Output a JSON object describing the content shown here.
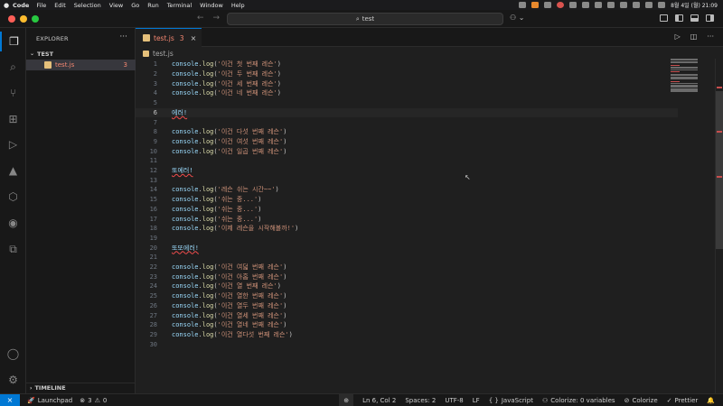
{
  "menubar": {
    "app": "Code",
    "items": [
      "File",
      "Edit",
      "Selection",
      "View",
      "Go",
      "Run",
      "Terminal",
      "Window",
      "Help"
    ],
    "clock": "8월 4일 (월) 21:09"
  },
  "titlebar": {
    "search_text": "test"
  },
  "sidebar": {
    "header": "EXPLORER",
    "folder": "TEST",
    "file_name": "test.js",
    "file_problems": "3",
    "timeline": "TIMELINE"
  },
  "tab": {
    "label": "test.js",
    "problems": "3"
  },
  "breadcrumb": {
    "file": "test.js"
  },
  "editor": {
    "current_line": 6,
    "lines": [
      {
        "n": "1",
        "kind": "log",
        "arg": "'이건 첫 번째 레슨'"
      },
      {
        "n": "2",
        "kind": "log",
        "arg": "'이건 두 번째 레슨'"
      },
      {
        "n": "3",
        "kind": "log",
        "arg": "'이건 세 번째 레슨'"
      },
      {
        "n": "4",
        "kind": "log",
        "arg": "'이건 네 번째 레슨'"
      },
      {
        "n": "5",
        "kind": "blank",
        "arg": ""
      },
      {
        "n": "6",
        "kind": "err",
        "arg": "에러!"
      },
      {
        "n": "7",
        "kind": "blank",
        "arg": ""
      },
      {
        "n": "8",
        "kind": "log",
        "arg": "'이건 다섯 번째 레슨'"
      },
      {
        "n": "9",
        "kind": "log",
        "arg": "'이건 여섯 번째 레슨'"
      },
      {
        "n": "10",
        "kind": "log",
        "arg": "'이건 일곱 번째 레슨'"
      },
      {
        "n": "11",
        "kind": "blank",
        "arg": ""
      },
      {
        "n": "12",
        "kind": "err",
        "arg": "또에러!"
      },
      {
        "n": "13",
        "kind": "blank",
        "arg": ""
      },
      {
        "n": "14",
        "kind": "log",
        "arg": "'레슨 쉬는 시간~~'"
      },
      {
        "n": "15",
        "kind": "log",
        "arg": "'쉬는 중...'"
      },
      {
        "n": "16",
        "kind": "log",
        "arg": "'쉬는 중...'"
      },
      {
        "n": "17",
        "kind": "log",
        "arg": "'쉬는 중...'"
      },
      {
        "n": "18",
        "kind": "log",
        "arg": "'이제 레슨을 시작해볼까!'"
      },
      {
        "n": "19",
        "kind": "blank",
        "arg": ""
      },
      {
        "n": "20",
        "kind": "err",
        "arg": "또또에러!"
      },
      {
        "n": "21",
        "kind": "blank",
        "arg": ""
      },
      {
        "n": "22",
        "kind": "log",
        "arg": "'이건 여덟 번째 레슨'"
      },
      {
        "n": "23",
        "kind": "log",
        "arg": "'이건 아홉 번째 레슨'"
      },
      {
        "n": "24",
        "kind": "log",
        "arg": "'이건 열 번째 레슨'"
      },
      {
        "n": "25",
        "kind": "log",
        "arg": "'이건 열한 번째 레슨'"
      },
      {
        "n": "26",
        "kind": "log",
        "arg": "'이건 열두 번째 레슨'"
      },
      {
        "n": "27",
        "kind": "log",
        "arg": "'이건 열세 번째 레슨'"
      },
      {
        "n": "28",
        "kind": "log",
        "arg": "'이건 열네 번째 레슨'"
      },
      {
        "n": "29",
        "kind": "log",
        "arg": "'이건 열다섯 번째 레슨'"
      },
      {
        "n": "30",
        "kind": "blank",
        "arg": ""
      }
    ],
    "log_object": "console",
    "log_method": "log"
  },
  "status": {
    "launchpad": "Launchpad",
    "errors": "3",
    "warnings": "0",
    "position": "Ln 6, Col 2",
    "spaces": "Spaces: 2",
    "encoding": "UTF-8",
    "eol": "LF",
    "language": "JavaScript",
    "colorize_vars": "Colorize: 0 variables",
    "colorize": "Colorize",
    "prettier": "Prettier"
  },
  "colors": {
    "accent": "#0078d4",
    "error": "#f48771",
    "string": "#ce9178",
    "function": "#dcdcaa",
    "variable": "#9cdcfe"
  }
}
